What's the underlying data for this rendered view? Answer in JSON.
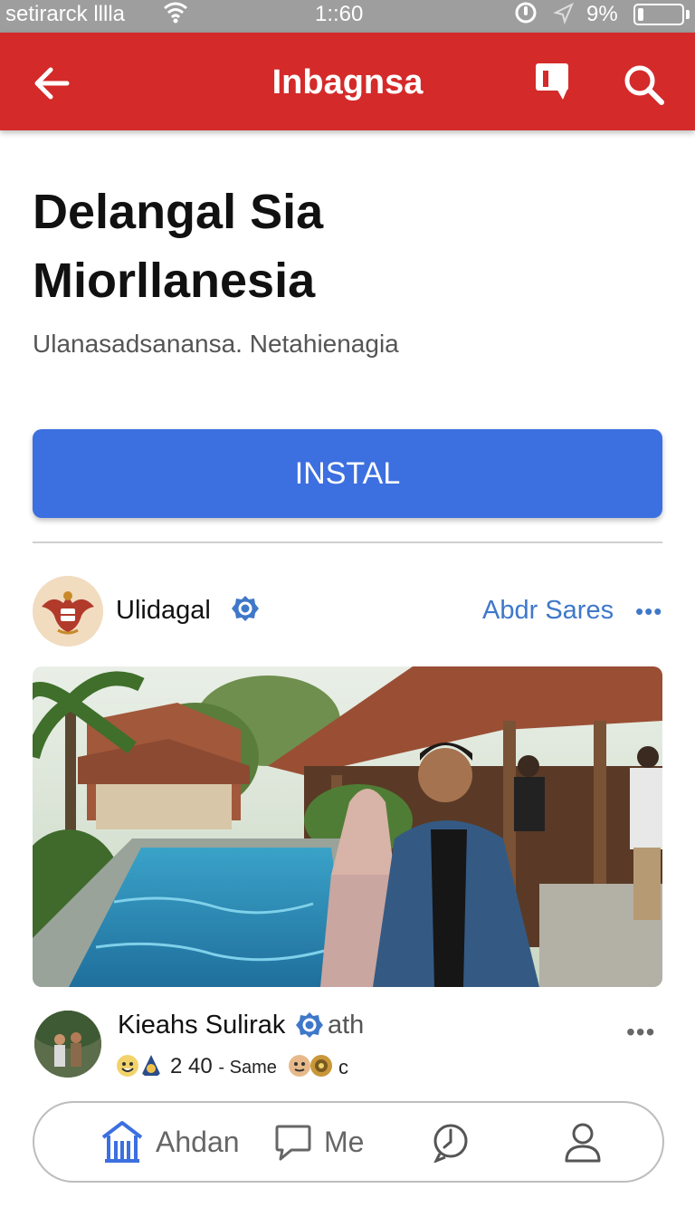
{
  "status_bar": {
    "carrier": "setirarck lllla",
    "time": "1::60",
    "battery_percent": "9%",
    "battery_level": 0.09
  },
  "app_bar": {
    "title": "Inbagnsa",
    "icons": [
      "back-arrow-icon",
      "chat-icon",
      "search-icon"
    ]
  },
  "app": {
    "title_line1": "Delangal Sia",
    "title_line2": "Miorllanesia",
    "subtitle": "Ulanasadsanansa. Netahienagia",
    "install_label": "INSTAL"
  },
  "page": {
    "name": "Ulidagal",
    "follow_label": "Abdr Sares",
    "more": "•••"
  },
  "post": {
    "image_icon": "photo-pool-people"
  },
  "commenter": {
    "name": "Kieahs Sulirak",
    "suffix": "ath",
    "more": "•••",
    "reaction_count": "2 40",
    "reaction_label": "- Same",
    "reaction_tail": "c"
  },
  "bottom_nav": {
    "items": [
      {
        "label": "Ahdan",
        "icon": "home-icon"
      },
      {
        "label": "Me",
        "icon": "chat-bubble-icon"
      },
      {
        "label": "",
        "icon": "clock-icon"
      },
      {
        "label": "",
        "icon": "profile-icon"
      }
    ]
  },
  "colors": {
    "app_bar": "#d42a2a",
    "install_button": "#3c6fe0",
    "link": "#3f78c9",
    "status_bar": "#9e9e9e",
    "nav_icon_active": "#3c6fe0"
  }
}
